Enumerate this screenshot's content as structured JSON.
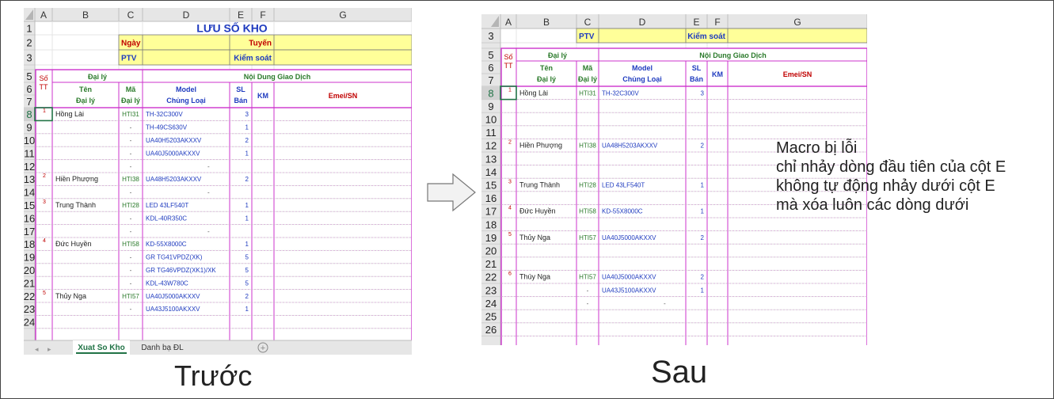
{
  "before_sheet": {
    "column_headers": [
      "A",
      "B",
      "C",
      "D",
      "E",
      "F",
      "G"
    ],
    "title": "LƯU SỐ KHO",
    "form": {
      "ngay_label": "Ngày",
      "tuyen_label": "Tuyến",
      "ptv_label": "PTV",
      "kiem_soat_label": "Kiểm soát"
    },
    "table_headers": {
      "dai_ly": "Đại lý",
      "noi_dung": "Nội Dung Giao Dịch",
      "so_tt": [
        "Số",
        "TT"
      ],
      "ten": [
        "Tên",
        "Đại lý"
      ],
      "ma": [
        "Mã",
        "Đại lý"
      ],
      "model": [
        "Model",
        "Chủng Loại"
      ],
      "sl": [
        "SL",
        "Bán"
      ],
      "km": "KM",
      "emei": "Emei/SN"
    },
    "rows": [
      {
        "row": "1"
      },
      {
        "row": "2"
      },
      {
        "row": "3"
      },
      {
        "row": "4"
      },
      {
        "row": "5"
      },
      {
        "row": "6"
      },
      {
        "row": "7"
      },
      {
        "row": "8",
        "stt": "1",
        "ten": "Hồng Lài",
        "ma": "HTI31",
        "model": "TH-32C300V",
        "sl": "3"
      },
      {
        "row": "9",
        "ma": "-",
        "model": "TH-49CS630V",
        "sl": "1"
      },
      {
        "row": "10",
        "ma": "-",
        "model": "UA40H5203AKXXV",
        "sl": "2"
      },
      {
        "row": "11",
        "ma": "-",
        "model": "UA40J5000AKXXV",
        "sl": "1"
      },
      {
        "row": "12",
        "ma": "-",
        "model": "-",
        "dash_mid": true
      },
      {
        "row": "13",
        "stt": "2",
        "ten": "Hiền Phượng",
        "ma": "HTI38",
        "model": "UA48H5203AKXXV",
        "sl": "2"
      },
      {
        "row": "14",
        "ma": "-",
        "model": "-",
        "dash_mid": true
      },
      {
        "row": "15",
        "stt": "3",
        "ten": "Trung Thành",
        "ma": "HTI28",
        "model": "LED 43LF540T",
        "sl": "1"
      },
      {
        "row": "16",
        "ma": "-",
        "model": "KDL-40R350C",
        "sl": "1"
      },
      {
        "row": "17",
        "ma": "-",
        "model": "-",
        "dash_mid": true
      },
      {
        "row": "18",
        "stt": "4",
        "ten": "Đức Huyền",
        "ma": "HTI58",
        "model": "KD-55X8000C",
        "sl": "1"
      },
      {
        "row": "19",
        "ma": "-",
        "model": "GR TG41VPDZ(XK)",
        "sl": "5"
      },
      {
        "row": "20",
        "ma": "-",
        "model": "GR TG46VPDZ(XK1)/XK",
        "sl": "5"
      },
      {
        "row": "21",
        "ma": "-",
        "model": "KDL-43W780C",
        "sl": "5"
      },
      {
        "row": "22",
        "stt": "5",
        "ten": "Thủy Nga",
        "ma": "HTI57",
        "model": "UA40J5000AKXXV",
        "sl": "2"
      },
      {
        "row": "23",
        "ma": "-",
        "model": "UA43J5100AKXXV",
        "sl": "1"
      },
      {
        "row": "24"
      }
    ],
    "tabs": [
      {
        "label": "Xuat So Kho",
        "active": true
      },
      {
        "label": "Danh bạ ĐL",
        "active": false
      }
    ],
    "add_sheet_label": "+"
  },
  "after_sheet": {
    "column_headers": [
      "A",
      "B",
      "C",
      "D",
      "E",
      "F",
      "G"
    ],
    "form": {
      "ptv_label": "PTV",
      "kiem_soat_label": "Kiểm soát"
    },
    "table_headers": {
      "dai_ly": "Đại lý",
      "noi_dung": "Nội Dung Giao Dịch",
      "so_tt": [
        "Số",
        "TT"
      ],
      "ten": [
        "Tên",
        "Đại lý"
      ],
      "ma": [
        "Mã",
        "Đại lý"
      ],
      "model": [
        "Model",
        "Chủng Loại"
      ],
      "sl": [
        "SL",
        "Bán"
      ],
      "km": "KM",
      "emei": "Emei/SN"
    },
    "rows": [
      {
        "row": "3"
      },
      {
        "row": "4"
      },
      {
        "row": "5"
      },
      {
        "row": "6"
      },
      {
        "row": "7"
      },
      {
        "row": "8",
        "stt": "1",
        "ten": "Hồng Lài",
        "ma": "HTI31",
        "model": "TH-32C300V",
        "sl": "3"
      },
      {
        "row": "9"
      },
      {
        "row": "10"
      },
      {
        "row": "11"
      },
      {
        "row": "12",
        "stt": "2",
        "ten": "Hiền Phượng",
        "ma": "HTI38",
        "model": "UA48H5203AKXXV",
        "sl": "2"
      },
      {
        "row": "13"
      },
      {
        "row": "14"
      },
      {
        "row": "15",
        "stt": "3",
        "ten": "Trung Thành",
        "ma": "HTI28",
        "model": "LED 43LF540T",
        "sl": "1"
      },
      {
        "row": "16"
      },
      {
        "row": "17",
        "stt": "4",
        "ten": "Đức Huyền",
        "ma": "HTI58",
        "model": "KD-55X8000C",
        "sl": "1"
      },
      {
        "row": "18"
      },
      {
        "row": "19",
        "stt": "5",
        "ten": "Thủy Nga",
        "ma": "HTI57",
        "model": "UA40J5000AKXXV",
        "sl": "2"
      },
      {
        "row": "20"
      },
      {
        "row": "21"
      },
      {
        "row": "22",
        "stt": "6",
        "ten": "Thúy Nga",
        "ma": "HTI57",
        "model": "UA40J5000AKXXV",
        "sl": "2"
      },
      {
        "row": "23",
        "ma": "-",
        "model": "UA43J5100AKXXV",
        "sl": "1"
      },
      {
        "row": "24",
        "ma": "-",
        "model": "-",
        "dash_mid": true
      },
      {
        "row": "25"
      },
      {
        "row": "26"
      }
    ]
  },
  "captions": {
    "before": "Trước",
    "after": "Sau"
  },
  "note": [
    "Macro bị lỗi",
    "chỉ nhảy dòng đầu tiên của cột E",
    "không tự động nhảy dưới cột E",
    "mà xóa luôn các dòng dưới"
  ],
  "colors": {
    "header_bg": "#e6e6e6",
    "highlight_bg": "#ffff99",
    "magenta": "#cc33cc",
    "blue": "#1f3bbf",
    "red": "#c00000",
    "green": "#2a7a2a",
    "tab_green": "#217346"
  }
}
